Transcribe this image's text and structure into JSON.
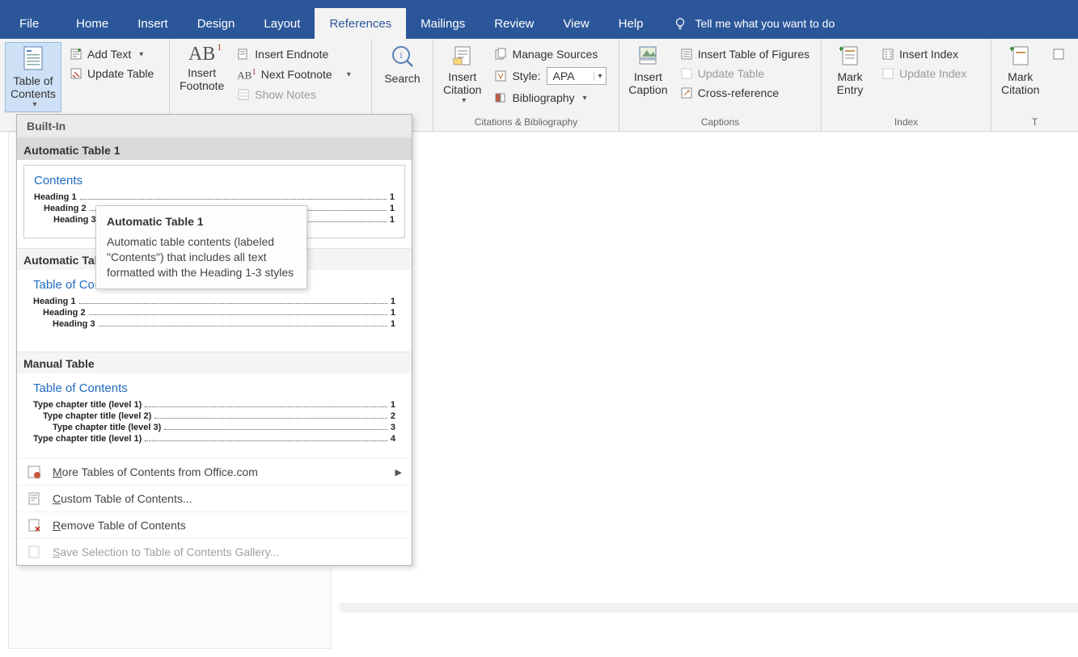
{
  "tabs": {
    "file": "File",
    "home": "Home",
    "insert": "Insert",
    "design": "Design",
    "layout": "Layout",
    "references": "References",
    "mailings": "Mailings",
    "review": "Review",
    "view": "View",
    "help": "Help"
  },
  "tellme_placeholder": "Tell me what you want to do",
  "ribbon": {
    "toc_button": "Table of\nContents",
    "add_text": "Add Text",
    "update_table": "Update Table",
    "insert_footnote": "Insert\nFootnote",
    "insert_endnote": "Insert Endnote",
    "next_footnote": "Next Footnote",
    "show_notes": "Show Notes",
    "search": "Search",
    "insert_citation": "Insert\nCitation",
    "manage_sources": "Manage Sources",
    "style_label": "Style:",
    "style_value": "APA",
    "bibliography": "Bibliography",
    "insert_caption": "Insert\nCaption",
    "insert_tof": "Insert Table of Figures",
    "update_table2": "Update Table",
    "cross_reference": "Cross-reference",
    "mark_entry": "Mark\nEntry",
    "insert_index": "Insert Index",
    "update_index": "Update Index",
    "mark_citation": "Mark\nCitation",
    "group_citations": "Citations & Bibliography",
    "group_captions": "Captions",
    "group_index": "Index"
  },
  "dropdown": {
    "built_in": "Built-In",
    "option1_title": "Automatic Table 1",
    "option1_preview_title": "Contents",
    "option2_title": "Automatic Table 2",
    "option2_preview_title": "Table of Contents",
    "option3_title": "Manual Table",
    "option3_preview_title": "Table of Contents",
    "heading1": "Heading 1",
    "heading2": "Heading 2",
    "heading3": "Heading 3",
    "pg1": "1",
    "manual_r1": "Type chapter title (level 1)",
    "manual_r2": "Type chapter title (level 2)",
    "manual_r3": "Type chapter title (level 3)",
    "manual_r4": "Type chapter title (level 1)",
    "pg2": "2",
    "pg3": "3",
    "pg4": "4",
    "more_office": "More Tables of Contents from Office.com",
    "custom_toc": "Custom Table of Contents...",
    "remove_toc": "Remove Table of Contents",
    "save_selection": "Save Selection to Table of Contents Gallery..."
  },
  "tooltip": {
    "title": "Automatic Table 1",
    "body": "Automatic table contents (labeled \"Contents\") that includes all text formatted with the Heading 1-3 styles"
  }
}
